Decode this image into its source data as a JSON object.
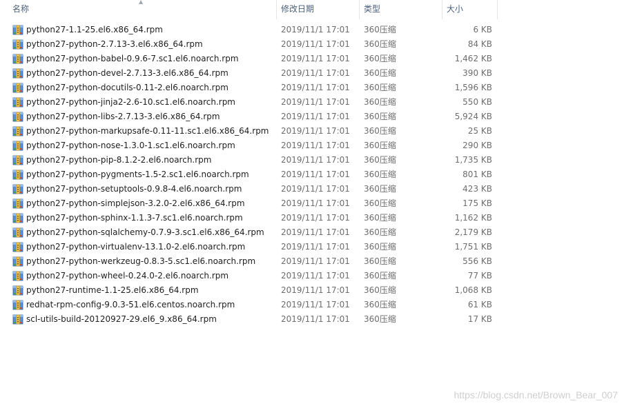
{
  "header": {
    "name_label": "名称",
    "date_label": "修改日期",
    "type_label": "类型",
    "size_label": "大小",
    "sort_icon": "chevron-up-icon"
  },
  "files": [
    {
      "name": "python27-1.1-25.el6.x86_64.rpm",
      "date": "2019/11/1 17:01",
      "type": "360压缩",
      "size": "6 KB"
    },
    {
      "name": "python27-python-2.7.13-3.el6.x86_64.rpm",
      "date": "2019/11/1 17:01",
      "type": "360压缩",
      "size": "84 KB"
    },
    {
      "name": "python27-python-babel-0.9.6-7.sc1.el6.noarch.rpm",
      "date": "2019/11/1 17:01",
      "type": "360压缩",
      "size": "1,462 KB"
    },
    {
      "name": "python27-python-devel-2.7.13-3.el6.x86_64.rpm",
      "date": "2019/11/1 17:01",
      "type": "360压缩",
      "size": "390 KB"
    },
    {
      "name": "python27-python-docutils-0.11-2.el6.noarch.rpm",
      "date": "2019/11/1 17:01",
      "type": "360压缩",
      "size": "1,596 KB"
    },
    {
      "name": "python27-python-jinja2-2.6-10.sc1.el6.noarch.rpm",
      "date": "2019/11/1 17:01",
      "type": "360压缩",
      "size": "550 KB"
    },
    {
      "name": "python27-python-libs-2.7.13-3.el6.x86_64.rpm",
      "date": "2019/11/1 17:01",
      "type": "360压缩",
      "size": "5,924 KB"
    },
    {
      "name": "python27-python-markupsafe-0.11-11.sc1.el6.x86_64.rpm",
      "date": "2019/11/1 17:01",
      "type": "360压缩",
      "size": "25 KB"
    },
    {
      "name": "python27-python-nose-1.3.0-1.sc1.el6.noarch.rpm",
      "date": "2019/11/1 17:01",
      "type": "360压缩",
      "size": "290 KB"
    },
    {
      "name": "python27-python-pip-8.1.2-2.el6.noarch.rpm",
      "date": "2019/11/1 17:01",
      "type": "360压缩",
      "size": "1,735 KB"
    },
    {
      "name": "python27-python-pygments-1.5-2.sc1.el6.noarch.rpm",
      "date": "2019/11/1 17:01",
      "type": "360压缩",
      "size": "801 KB"
    },
    {
      "name": "python27-python-setuptools-0.9.8-4.el6.noarch.rpm",
      "date": "2019/11/1 17:01",
      "type": "360压缩",
      "size": "423 KB"
    },
    {
      "name": "python27-python-simplejson-3.2.0-2.el6.x86_64.rpm",
      "date": "2019/11/1 17:01",
      "type": "360压缩",
      "size": "175 KB"
    },
    {
      "name": "python27-python-sphinx-1.1.3-7.sc1.el6.noarch.rpm",
      "date": "2019/11/1 17:01",
      "type": "360压缩",
      "size": "1,162 KB"
    },
    {
      "name": "python27-python-sqlalchemy-0.7.9-3.sc1.el6.x86_64.rpm",
      "date": "2019/11/1 17:01",
      "type": "360压缩",
      "size": "2,179 KB"
    },
    {
      "name": "python27-python-virtualenv-13.1.0-2.el6.noarch.rpm",
      "date": "2019/11/1 17:01",
      "type": "360压缩",
      "size": "1,751 KB"
    },
    {
      "name": "python27-python-werkzeug-0.8.3-5.sc1.el6.noarch.rpm",
      "date": "2019/11/1 17:01",
      "type": "360压缩",
      "size": "556 KB"
    },
    {
      "name": "python27-python-wheel-0.24.0-2.el6.noarch.rpm",
      "date": "2019/11/1 17:01",
      "type": "360压缩",
      "size": "77 KB"
    },
    {
      "name": "python27-runtime-1.1-25.el6.x86_64.rpm",
      "date": "2019/11/1 17:01",
      "type": "360压缩",
      "size": "1,068 KB"
    },
    {
      "name": "redhat-rpm-config-9.0.3-51.el6.centos.noarch.rpm",
      "date": "2019/11/1 17:01",
      "type": "360压缩",
      "size": "61 KB"
    },
    {
      "name": "scl-utils-build-20120927-29.el6_9.x86_64.rpm",
      "date": "2019/11/1 17:01",
      "type": "360压缩",
      "size": "17 KB"
    }
  ],
  "file_icon": "archive-file-icon",
  "watermark": "https://blog.csdn.net/Brown_Bear_007",
  "colors": {
    "header_text": "#4c607a",
    "detail_text": "#6d6d6d",
    "name_text": "#1e1e1e"
  }
}
